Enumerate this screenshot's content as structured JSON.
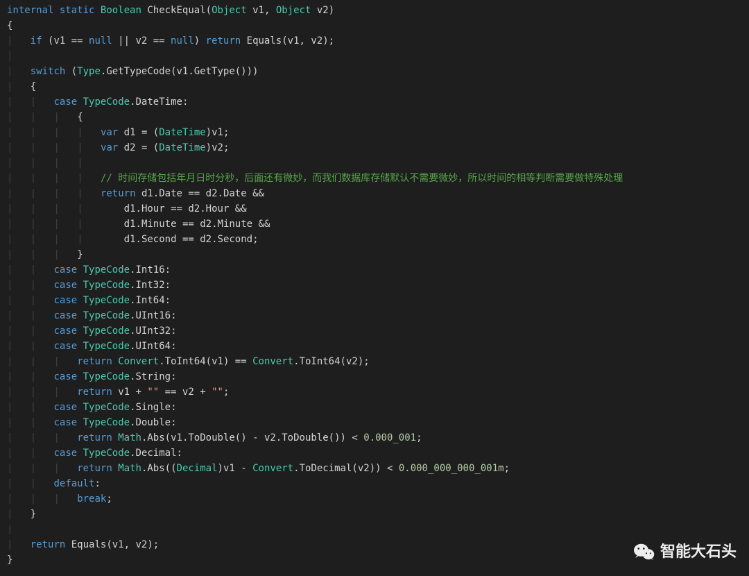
{
  "code": {
    "sig_kw1": "internal",
    "sig_kw2": "static",
    "sig_type": "Boolean",
    "sig_name": "CheckEqual",
    "sig_p1type": "Object",
    "sig_p1name": "v1",
    "sig_p2type": "Object",
    "sig_p2name": "v2",
    "lbrace": "{",
    "rbrace": "}",
    "if": "if",
    "null": "null",
    "return": "return",
    "equals_call": "Equals(v1, v2);",
    "switch": "switch",
    "type_tok": "Type",
    "gettypecode": ".GetTypeCode(v1.GetType()))",
    "case": "case",
    "typecode": "TypeCode",
    "datetime_lbl": "DateTime",
    "var": "var",
    "d1_eq": " d1 = (",
    "d2_eq": " d2 = (",
    "datetime_type": "DateTime",
    "cast_end_v1": ")v1;",
    "cast_end_v2": ")v2;",
    "comment": "// 时间存储包括年月日时分秒，后面还有微妙，而我们数据库存储默认不需要微妙，所以时间的相等判断需要做特殊处理",
    "ret_date": " d1.Date == d2.Date &&",
    "ret_hour": "d1.Hour == d2.Hour &&",
    "ret_min": "d1.Minute == d2.Minute &&",
    "ret_sec": "d1.Second == d2.Second;",
    "int16": "Int16",
    "int32": "Int32",
    "int64": "Int64",
    "uint16": "UInt16",
    "uint32": "UInt32",
    "uint64": "UInt64",
    "convert": "Convert",
    "toint64_a": ".ToInt64(v1) == ",
    "toint64_b": ".ToInt64(v2);",
    "string_lbl": "String",
    "str_q1": "\"\"",
    "str_q2": "\"\"",
    "str_ret_a": " v1 + ",
    "str_ret_b": " == v2 + ",
    "str_ret_c": ";",
    "single_lbl": "Single",
    "double_lbl": "Double",
    "math": "Math",
    "abs_dbl": ".Abs(v1.ToDouble() - v2.ToDouble()) < ",
    "num_dbl": "0.000_001",
    "decimal_lbl": "Decimal",
    "abs_dec_a": ".Abs((",
    "decimal_type": "Decimal",
    "abs_dec_b": ")v1 - ",
    "abs_dec_c": ".ToDecimal(v2)) < ",
    "num_dec": "0.000_000_000_001m",
    "default": "default",
    "break": "break",
    "final_ret": " Equals(v1, v2);"
  },
  "watermark": {
    "text": "智能大石头"
  }
}
